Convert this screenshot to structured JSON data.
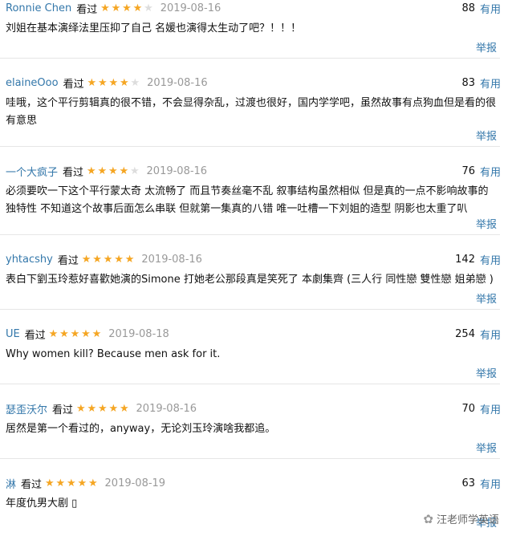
{
  "reviews": [
    {
      "user": "Ronnie Chen",
      "seen": "看过",
      "rating": 4,
      "date": "2019-08-16",
      "count": "88",
      "helpful": "有用",
      "lines": [
        "刘姐在基本演绎法里压抑了自己 名媛也演得太生动了吧？！！！"
      ],
      "report": "举报"
    },
    {
      "user": "elaineOoo",
      "seen": "看过",
      "rating": 4,
      "date": "2019-08-16",
      "count": "83",
      "helpful": "有用",
      "lines": [
        "哇哦，这个平行剪辑真的很不错，不会显得杂乱，过渡也很好，国内学学吧，虽然故事有点狗血但是看的很",
        "有意思"
      ],
      "report": "举报"
    },
    {
      "user": "一个大疯子",
      "seen": "看过",
      "rating": 4,
      "date": "2019-08-16",
      "count": "76",
      "helpful": "有用",
      "lines": [
        "必须要吹一下这个平行蒙太奇 太流畅了 而且节奏丝毫不乱 叙事结构虽然相似 但是真的一点不影响故事的",
        "独特性 不知道这个故事后面怎么串联 但就第一集真的八错 唯一吐槽一下刘姐的造型 阴影也太重了叭"
      ],
      "report": "举报"
    },
    {
      "user": "yhtacshy",
      "seen": "看过",
      "rating": 5,
      "date": "2019-08-16",
      "count": "142",
      "helpful": "有用",
      "lines": [
        "表白下劉玉玲惹好喜歡她演的Simone 打她老公那段真是笑死了 本劇集齊 (三人行 同性戀 雙性戀 姐弟戀 )"
      ],
      "report": "举报"
    },
    {
      "user": "UE",
      "seen": "看过",
      "rating": 5,
      "date": "2019-08-18",
      "count": "254",
      "helpful": "有用",
      "lines": [
        "Why women kill? Because men ask for it."
      ],
      "report": "举报"
    },
    {
      "user": "瑟歪沃尔",
      "seen": "看过",
      "rating": 5,
      "date": "2019-08-16",
      "count": "70",
      "helpful": "有用",
      "lines": [
        "居然是第一个看过的，anyway，无论刘玉玲演啥我都追。"
      ],
      "report": "举报"
    },
    {
      "user": "淋",
      "seen": "看过",
      "rating": 5,
      "date": "2019-08-19",
      "count": "63",
      "helpful": "有用",
      "lines": [
        "年度仇男大剧 ▯"
      ],
      "report": "举报"
    }
  ],
  "watermark": {
    "icon": "wechat-icon",
    "text": "汪老师学英语"
  },
  "colors": {
    "link": "#3377aa",
    "star": "#f5a623",
    "star_empty": "#dddddd",
    "date": "#999999",
    "divider": "#e6e6e6"
  }
}
